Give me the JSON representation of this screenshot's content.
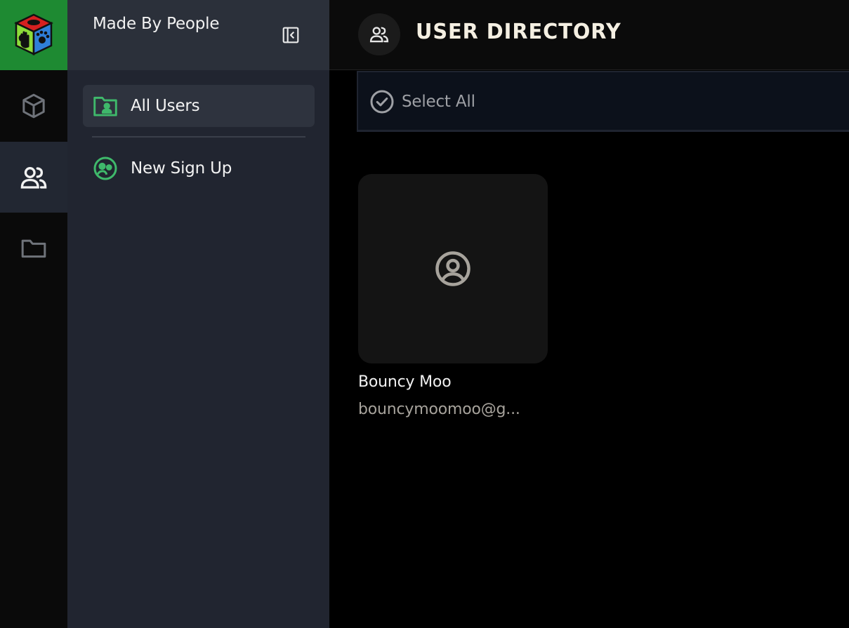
{
  "app": {
    "logo_icon": "app-logo-cube-icon",
    "accent_color": "#1e8a32"
  },
  "rail": {
    "items": [
      {
        "icon": "cube-icon",
        "active": false
      },
      {
        "icon": "users-icon",
        "active": true
      },
      {
        "icon": "folder-icon",
        "active": false
      }
    ]
  },
  "sidebar": {
    "workspace_name": "Made By People",
    "collapse_icon": "collapse-sidebar-icon",
    "items": [
      {
        "label": "All Users",
        "icon": "folder-user-icon",
        "active": true
      },
      {
        "label": "New Sign Up",
        "icon": "user-group-circle-icon",
        "active": false
      }
    ],
    "icon_color": "#3fb96b"
  },
  "header": {
    "title": "User Directory",
    "icon": "users-icon"
  },
  "toolbar": {
    "select_all_label": "Select All",
    "select_all_icon": "check-circle-icon"
  },
  "users": [
    {
      "name": "Bouncy Moo",
      "email": "bouncymoomoo@g...",
      "avatar_icon": "user-circle-icon"
    }
  ]
}
